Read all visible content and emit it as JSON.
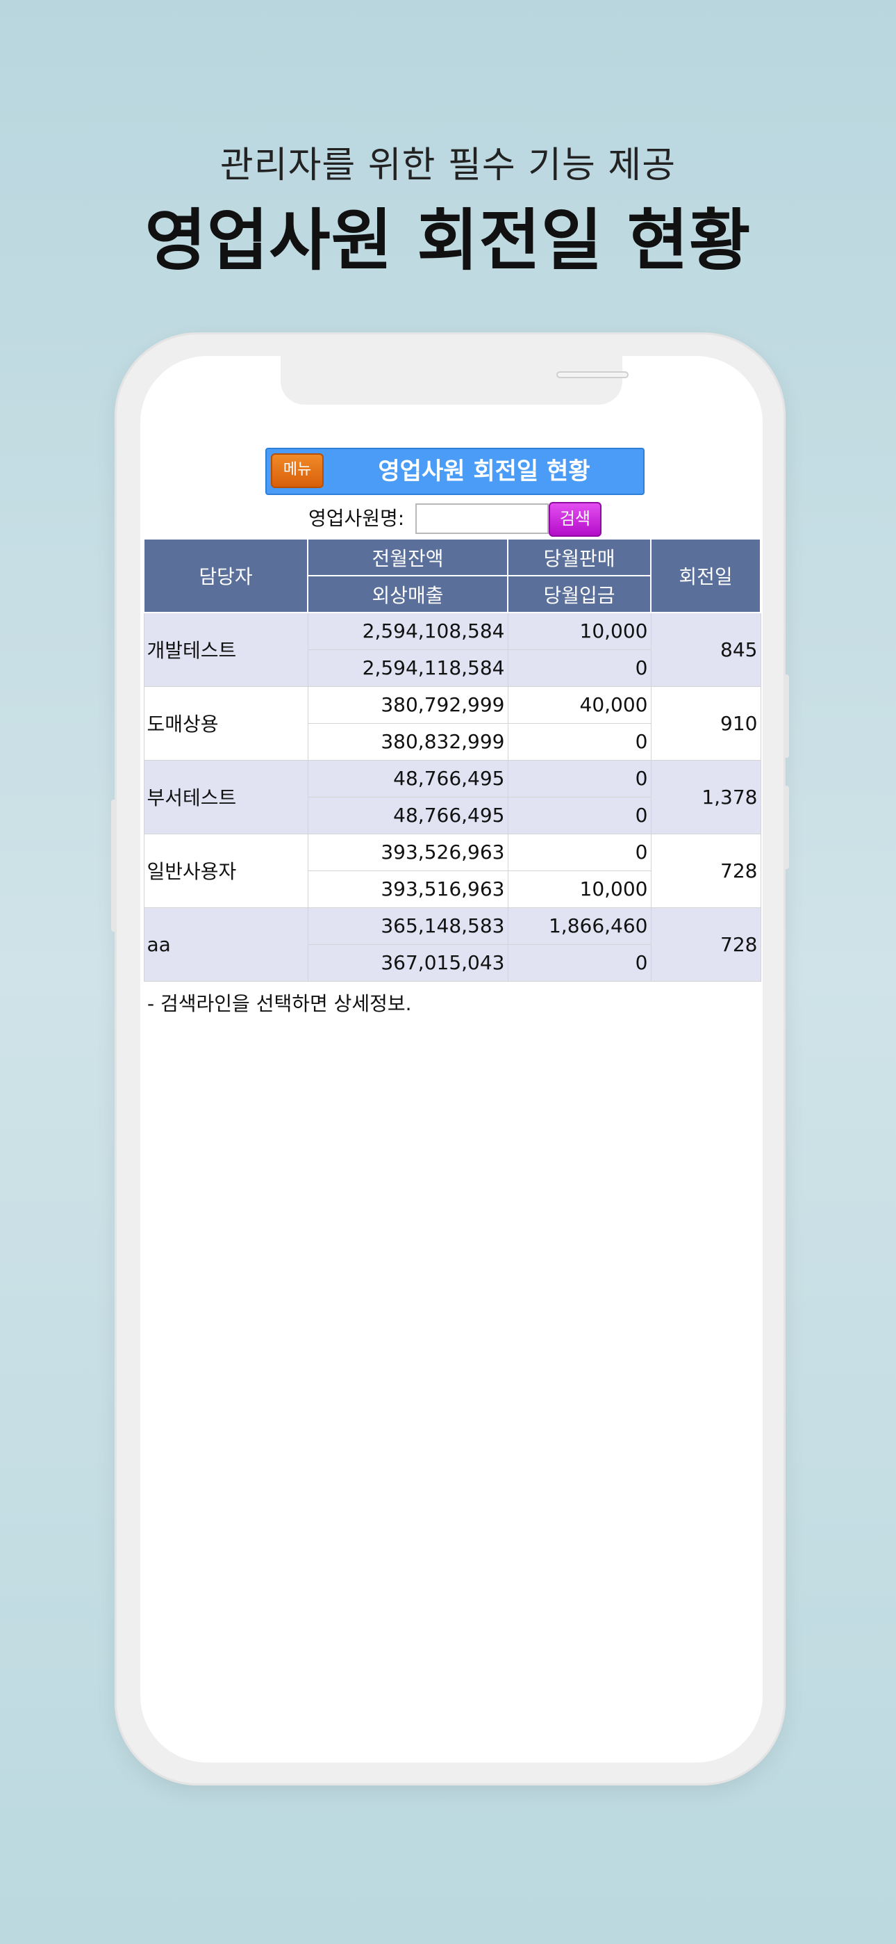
{
  "promo": {
    "subtitle": "관리자를 위한 필수 기능 제공",
    "title": "영업사원 회전일 현황"
  },
  "app": {
    "menu_label": "메뉴",
    "header_title": "영업사원 회전일 현황",
    "search": {
      "label": "영업사원명:",
      "input_value": "",
      "button_label": "검색"
    },
    "table": {
      "headers": {
        "manager": "담당자",
        "prev_balance": "전월잔액",
        "month_sales": "당월판매",
        "credit_sales": "외상매출",
        "month_deposit": "당월입금",
        "turnover_days": "회전일"
      },
      "rows": [
        {
          "name": "개발테스트",
          "prev_balance": "2,594,108,584",
          "month_sales": "10,000",
          "credit_sales": "2,594,118,584",
          "month_deposit": "0",
          "turnover_days": "845"
        },
        {
          "name": "도매상용",
          "prev_balance": "380,792,999",
          "month_sales": "40,000",
          "credit_sales": "380,832,999",
          "month_deposit": "0",
          "turnover_days": "910"
        },
        {
          "name": "부서테스트",
          "prev_balance": "48,766,495",
          "month_sales": "0",
          "credit_sales": "48,766,495",
          "month_deposit": "0",
          "turnover_days": "1,378"
        },
        {
          "name": "일반사용자",
          "prev_balance": "393,526,963",
          "month_sales": "0",
          "credit_sales": "393,516,963",
          "month_deposit": "10,000",
          "turnover_days": "728"
        },
        {
          "name": "aa",
          "prev_balance": "365,148,583",
          "month_sales": "1,866,460",
          "credit_sales": "367,015,043",
          "month_deposit": "0",
          "turnover_days": "728"
        }
      ]
    },
    "footnote": "- 검색라인을 선택하면 상세정보."
  }
}
